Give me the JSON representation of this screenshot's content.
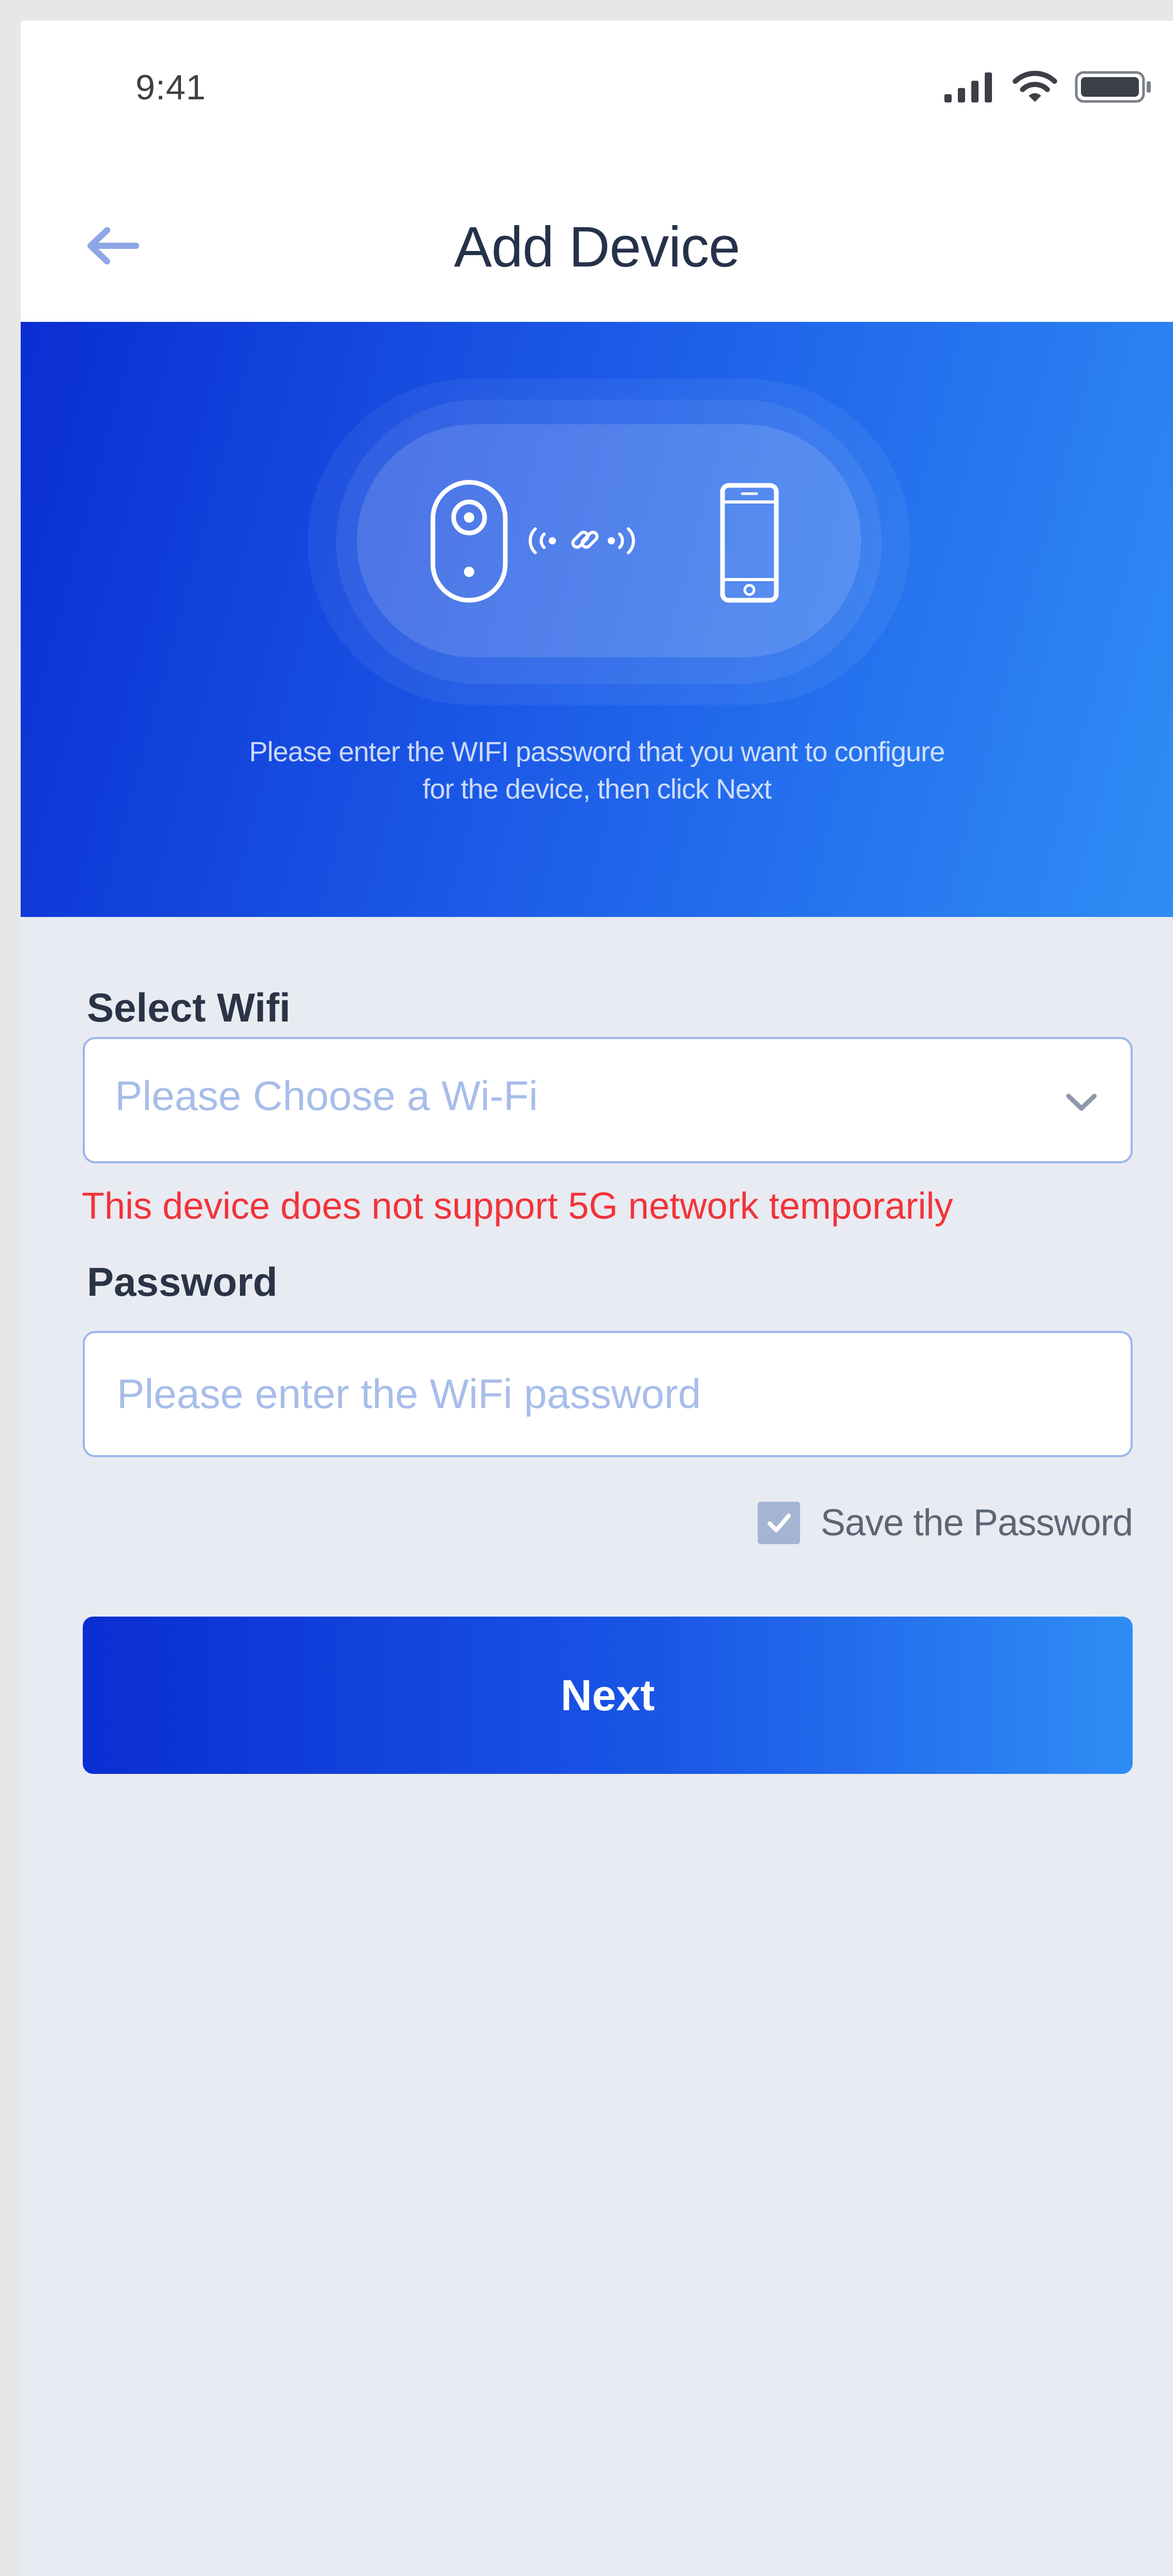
{
  "status_bar": {
    "time": "9:41",
    "icons": [
      "signal-icon",
      "wifi-icon",
      "battery-icon"
    ]
  },
  "nav": {
    "back_icon": "arrow-left-icon",
    "title": "Add Device"
  },
  "hero": {
    "illustration": [
      "camera-device-icon",
      "signal-link-icon",
      "smartphone-icon"
    ],
    "instruction_line1": "Please enter the WIFI password that you want to configure",
    "instruction_line2": "for the device, then click Next"
  },
  "form": {
    "wifi_label": "Select Wifi",
    "wifi_placeholder": "Please Choose a Wi-Fi",
    "wifi_warning": "This device does not support 5G network temporarily",
    "password_label": "Password",
    "password_placeholder": "Please enter the WiFi password",
    "save_password_label": "Save the Password",
    "save_password_checked": true,
    "next_label": "Next"
  },
  "colors": {
    "accent": "#1a56e6",
    "gradient_start": "#0a2ed2",
    "gradient_end": "#2f8df5",
    "warning": "#f2333a",
    "placeholder": "#a7bdea",
    "background": "#e8ebf1"
  }
}
